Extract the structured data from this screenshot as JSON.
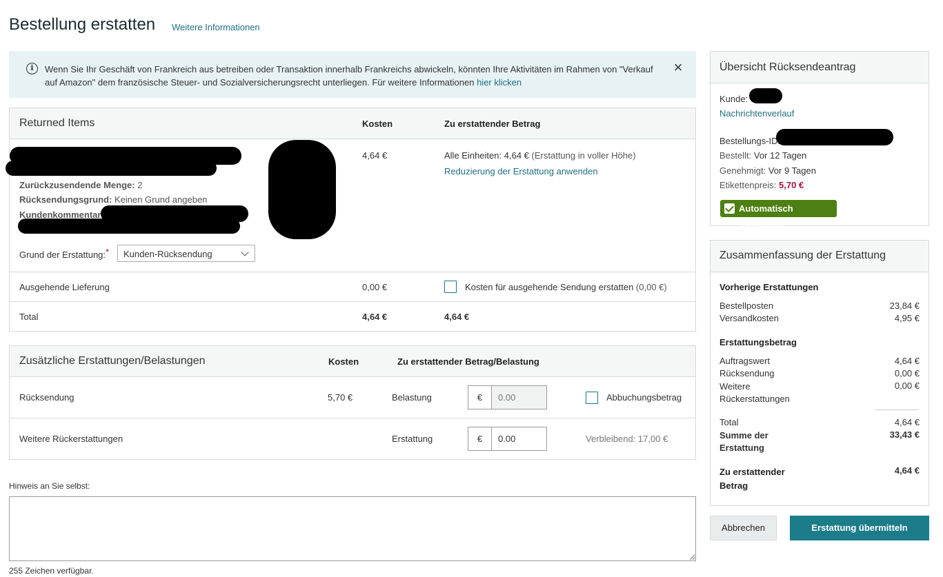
{
  "header": {
    "title": "Bestellung erstatten",
    "more_info_link": "Weitere Informationen"
  },
  "info_banner": {
    "text": "Wenn Sie Ihr Geschäft von Frankreich aus betreiben oder Transaktion innerhalb Frankreichs abwickeln, könnten Ihre Aktivitäten im Rahmen von \"Verkauf auf Amazon\" dem französische Steuer- und Sozialversicherungsrecht unterliegen. Für weitere Informationen",
    "link": "hier klicken",
    "icon": "info-icon",
    "close_icon": "close-icon"
  },
  "returned_items": {
    "title": "Returned Items",
    "col_cost": "Kosten",
    "col_refund": "Zu erstattender Betrag",
    "item": {
      "qty_label": "Zurückzusendende Menge:",
      "qty_value": "2",
      "reason_label": "Rücksendungsgrund:",
      "reason_value": "Keinen Grund angeben",
      "comment_label": "Kundenkommentar:",
      "cost": "4,64 €",
      "all_units_label": "Alle Einheiten:",
      "all_units_value": "4,64 €",
      "full_refund_note": "(Erstattung in voller Höhe)",
      "reduce_link": "Reduzierung der Erstattung anwenden",
      "refund_reason_label": "Grund der Erstattung:",
      "required_mark": "*",
      "refund_reason_value": "Kunden-Rücksendung"
    },
    "outbound": {
      "label": "Ausgehende Lieferung",
      "cost": "0,00 €",
      "checkbox_label": "Kosten für ausgehende Sendung erstatten",
      "checkbox_amount": "(0,00 €)"
    },
    "total": {
      "label": "Total",
      "cost": "4,64 €",
      "refund": "4,64 €"
    }
  },
  "additional": {
    "title": "Zusätzliche Erstattungen/Belastungen",
    "col_cost": "Kosten",
    "col_amount": "Zu erstattender Betrag/Belastung",
    "rows": [
      {
        "label": "Rücksendung",
        "cost": "5,70 €",
        "type": "Belastung",
        "currency": "€",
        "placeholder": "0.00",
        "extra": "Abbuchungsbetrag"
      },
      {
        "label": "Weitere Rückerstattungen",
        "cost": "",
        "type": "Erstattung",
        "currency": "€",
        "value": "0.00",
        "extra": "Verbleibend: 17,00 €"
      }
    ]
  },
  "note": {
    "label": "Hinweis an Sie selbst:",
    "chars_left": "255 Zeichen verfügbar."
  },
  "overview": {
    "title": "Übersicht Rücksendeantrag",
    "customer_label": "Kunde:",
    "message_history_link": "Nachrichtenverlauf",
    "order_id_label": "Bestellungs-ID:",
    "ordered_label": "Bestellt:",
    "ordered_value": "Vor 12 Tagen",
    "approved_label": "Genehmigt:",
    "approved_value": "Vor 9 Tagen",
    "label_price_label": "Etikettenpreis:",
    "label_price_value": "5,70 €",
    "auto_badge": "Automatisch genehmigt"
  },
  "summary": {
    "title": "Zusammenfassung der Erstattung",
    "previous_heading": "Vorherige Erstattungen",
    "previous": [
      {
        "label": "Bestellposten",
        "value": "23,84 €"
      },
      {
        "label": "Versandkosten",
        "value": "4,95 €"
      }
    ],
    "refund_heading": "Erstattungsbetrag",
    "refund": [
      {
        "label": "Auftragswert",
        "value": "4,64 €"
      },
      {
        "label": "Rücksendung",
        "value": "0,00 €"
      },
      {
        "label": "Weitere Rückerstattungen",
        "value": "0,00 €"
      }
    ],
    "total_label": "Total",
    "total_value": "4,64 €",
    "sum_label": "Summe der Erstattung",
    "sum_value": "33,43 €",
    "to_refund_label": "Zu erstattender Betrag",
    "to_refund_value": "4,64 €"
  },
  "buttons": {
    "cancel": "Abbrechen",
    "submit": "Erstattung übermitteln"
  },
  "colors": {
    "accent": "#1d7c89",
    "link": "#1f6f80",
    "banner_bg": "#e6f2f3",
    "negative": "#b0123a",
    "badge_green": "#4e7f12"
  }
}
